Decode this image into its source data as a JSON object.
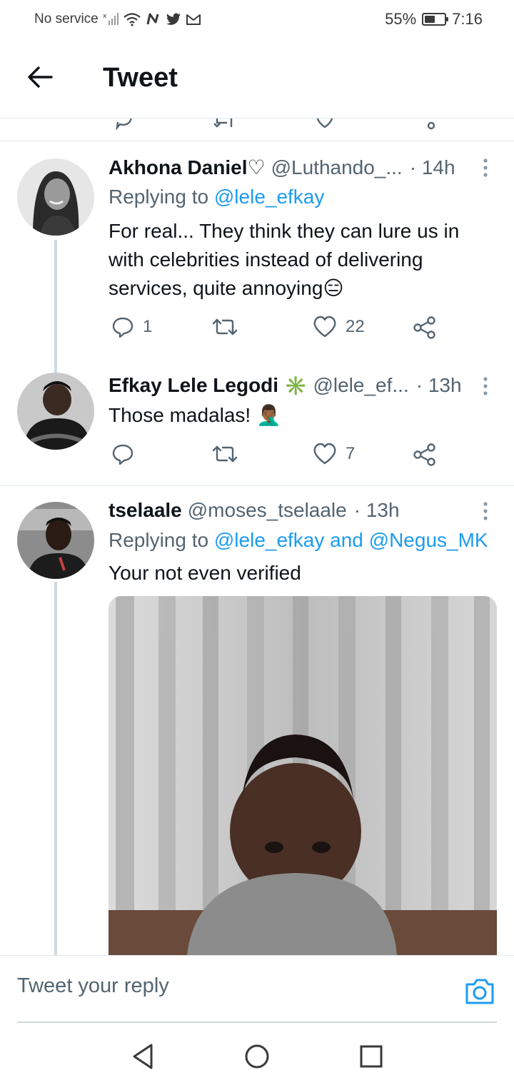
{
  "status_bar": {
    "carrier": "No service",
    "battery": "55%",
    "battery_level": 0.55,
    "time": "7:16"
  },
  "header": {
    "title": "Tweet"
  },
  "tweets": [
    {
      "name": "Akhona Daniel♡",
      "handle": "@Luthando_...",
      "time": "· 14h",
      "replying_prefix": "Replying to ",
      "replying_to": "@lele_efkay",
      "text": "For real... They think they can lure us in with celebrities instead of delivering services, quite annoying😑",
      "reply_count": "1",
      "retweet_count": "",
      "like_count": "22"
    },
    {
      "name": "Efkay Lele Legodi",
      "badge": "✳️",
      "handle": "@lele_ef...",
      "time": "· 13h",
      "text": "Those madalas! 🤦🏾‍♂️",
      "reply_count": "",
      "retweet_count": "",
      "like_count": "7"
    },
    {
      "name": "tselaale",
      "handle": "@moses_tselaale",
      "time": "· 13h",
      "replying_prefix": "Replying to ",
      "replying_to": "@lele_efkay and @Negus_MK",
      "text": "Your not even verified"
    }
  ],
  "reply_bar": {
    "placeholder": "Tweet your reply"
  },
  "icons": {
    "back": "arrow-left-icon",
    "more": "more-vertical-icon",
    "reply": "reply-icon",
    "retweet": "retweet-icon",
    "like": "heart-icon",
    "share": "share-icon",
    "camera": "camera-icon",
    "nav_back": "triangle-back-icon",
    "nav_home": "circle-home-icon",
    "nav_recents": "square-recents-icon"
  },
  "colors": {
    "accent": "#1d9bf0",
    "secondary_text": "#536471",
    "thread_line": "#cfd9de"
  }
}
